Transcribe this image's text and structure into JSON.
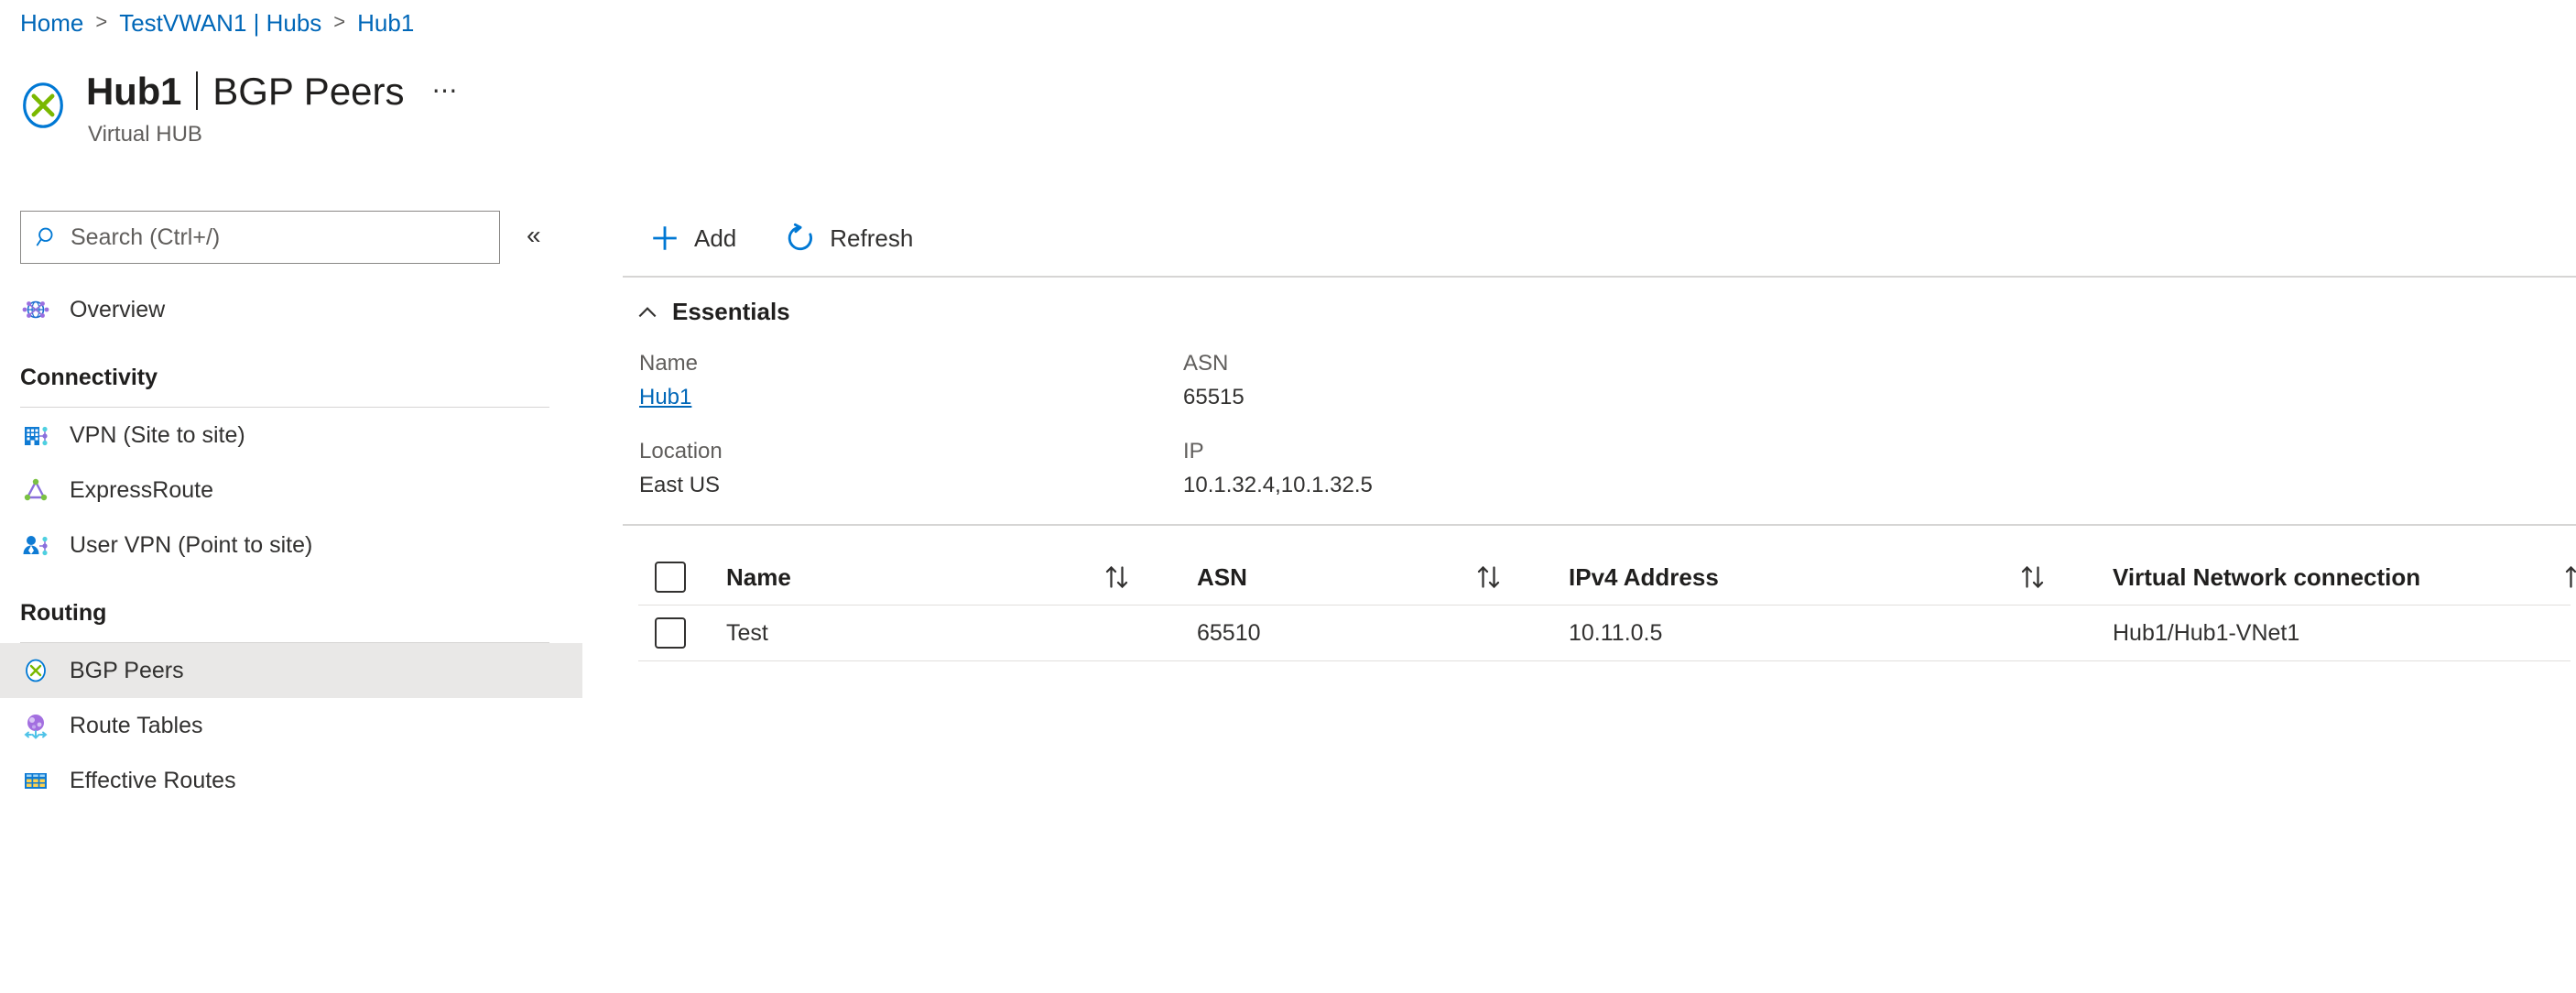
{
  "breadcrumb": {
    "items": [
      {
        "label": "Home"
      },
      {
        "label": "TestVWAN1 | Hubs"
      },
      {
        "label": "Hub1"
      }
    ],
    "separator": ">"
  },
  "header": {
    "title": "Hub1",
    "section": "BGP Peers",
    "subtitle": "Virtual HUB",
    "overflow_label": "⋯",
    "icon": "bgp-peer-icon"
  },
  "sidebar": {
    "search": {
      "placeholder": "Search (Ctrl+/)",
      "value": "",
      "icon": "search-icon"
    },
    "collapse_label": "«",
    "overview": {
      "label": "Overview",
      "icon": "overview-globe-icon"
    },
    "groups": [
      {
        "title": "Connectivity",
        "items": [
          {
            "label": "VPN (Site to site)",
            "icon": "vpn-site-to-site-icon",
            "selected": false
          },
          {
            "label": "ExpressRoute",
            "icon": "expressroute-icon",
            "selected": false
          },
          {
            "label": "User VPN (Point to site)",
            "icon": "user-vpn-icon",
            "selected": false
          }
        ]
      },
      {
        "title": "Routing",
        "items": [
          {
            "label": "BGP Peers",
            "icon": "bgp-peer-icon",
            "selected": true
          },
          {
            "label": "Route Tables",
            "icon": "route-tables-icon",
            "selected": false
          },
          {
            "label": "Effective Routes",
            "icon": "effective-routes-icon",
            "selected": false
          }
        ]
      }
    ]
  },
  "toolbar": {
    "add_label": "Add",
    "add_icon": "plus-icon",
    "refresh_label": "Refresh",
    "refresh_icon": "refresh-icon"
  },
  "essentials": {
    "header_label": "Essentials",
    "collapse_icon": "chevron-up-icon",
    "fields": [
      {
        "label": "Name",
        "value": "Hub1",
        "is_link": true
      },
      {
        "label": "ASN",
        "value": "65515",
        "is_link": false
      },
      {
        "label": "Location",
        "value": "East US",
        "is_link": false
      },
      {
        "label": "IP",
        "value": "10.1.32.4,10.1.32.5",
        "is_link": false
      }
    ]
  },
  "table": {
    "columns": [
      {
        "label": "Name",
        "sortable": true
      },
      {
        "label": "ASN",
        "sortable": true
      },
      {
        "label": "IPv4 Address",
        "sortable": true
      },
      {
        "label": "Virtual Network connection",
        "sortable": true
      }
    ],
    "sort_icon": "sort-arrows-icon",
    "row_menu_label": "•••",
    "rows": [
      {
        "selected": false,
        "name": "Test",
        "asn": "65510",
        "ipv4": "10.11.0.5",
        "vnet": "Hub1/Hub1-VNet1"
      }
    ]
  },
  "colors": {
    "link": "#0067b8",
    "accent": "#0078d4",
    "text": "#323130",
    "muted": "#605e5c",
    "selected_bg": "#e9e8e7",
    "rule": "#d6d5d4"
  }
}
